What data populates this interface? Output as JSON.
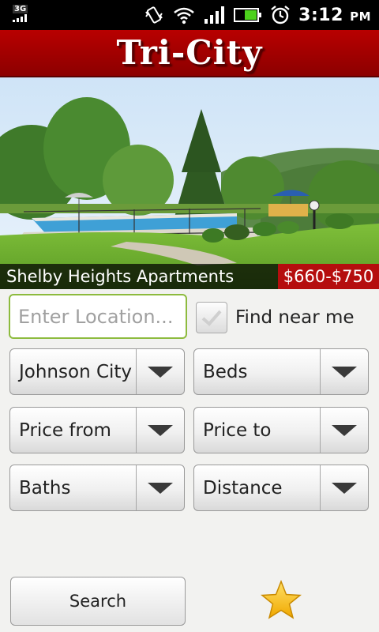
{
  "status_bar": {
    "network": "3G",
    "time": "3:12",
    "ampm": "PM"
  },
  "header": {
    "logo_text": "Tri-City"
  },
  "listing": {
    "name": "Shelby Heights Apartments",
    "price": "$660-$750"
  },
  "search": {
    "location_placeholder": "Enter Location...",
    "find_near_label": "Find near me",
    "find_near_checked": false
  },
  "filters": {
    "city": "Johnson City",
    "beds": "Beds",
    "price_from": "Price from",
    "price_to": "Price to",
    "baths": "Baths",
    "distance": "Distance"
  },
  "actions": {
    "search_label": "Search",
    "favorite_icon": "star-icon"
  },
  "colors": {
    "header_red": "#a00000",
    "price_red": "#b50e0e",
    "input_border": "#8dbb3e",
    "star": "#f7c21a"
  }
}
